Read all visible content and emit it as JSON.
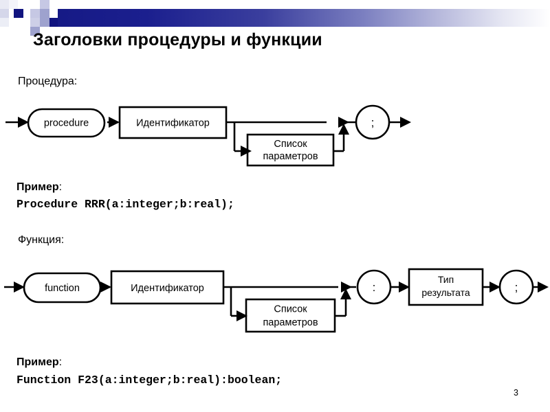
{
  "slide": {
    "title": "Заголовки процедуры и функции",
    "page_number": "3",
    "accent_color": "#161a86",
    "line_color": "#000000"
  },
  "header": {
    "decoration_name": "checkered-squares-and-gradient-bar",
    "gradient_from": "#161a86",
    "gradient_to": "#ffffff"
  },
  "sections": {
    "procedure": {
      "label": "Процедура:",
      "diagram": {
        "type": "railroad",
        "nodes": [
          {
            "id": "procedure-keyword",
            "shape": "stadium",
            "text": "procedure"
          },
          {
            "id": "identifier",
            "shape": "rect",
            "text": "Идентификатор"
          },
          {
            "id": "parameter-list",
            "shape": "rect",
            "text_line1": "Список",
            "text_line2": "параметров"
          },
          {
            "id": "semicolon",
            "shape": "circle",
            "text": ";"
          }
        ]
      },
      "example": {
        "label": "Пример",
        "label_colon": ":",
        "code": "Procedure RRR(a:integer;b:real);"
      }
    },
    "function": {
      "label": "Функция:",
      "diagram": {
        "type": "railroad",
        "nodes": [
          {
            "id": "function-keyword",
            "shape": "stadium",
            "text": "function"
          },
          {
            "id": "identifier",
            "shape": "rect",
            "text": "Идентификатор"
          },
          {
            "id": "parameter-list",
            "shape": "rect",
            "text_line1": "Список",
            "text_line2": "параметров"
          },
          {
            "id": "colon",
            "shape": "circle",
            "text": ":"
          },
          {
            "id": "result-type",
            "shape": "rect",
            "text_line1": "Тип",
            "text_line2": "результата"
          },
          {
            "id": "semicolon",
            "shape": "circle",
            "text": ";"
          }
        ]
      },
      "example": {
        "label": "Пример",
        "label_colon": ":",
        "code": "Function F23(a:integer;b:real):boolean;"
      }
    }
  }
}
